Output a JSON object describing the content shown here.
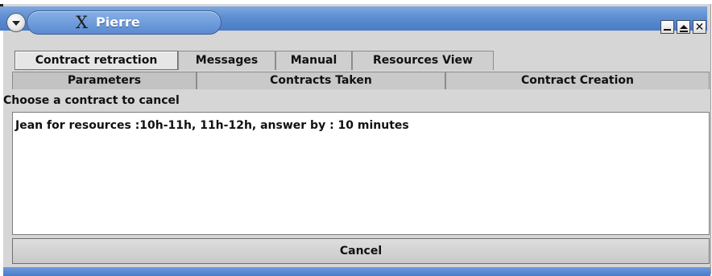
{
  "window": {
    "title": "Pierre",
    "title_icon": "x-logo-icon",
    "controls": [
      "minimize-icon",
      "maximize-icon",
      "close-icon"
    ]
  },
  "tabs_row1": [
    {
      "label": "Contract retraction",
      "active": true
    },
    {
      "label": "Messages",
      "active": false
    },
    {
      "label": "Manual",
      "active": false
    },
    {
      "label": "Resources View",
      "active": false
    }
  ],
  "tabs_row2": [
    {
      "label": "Parameters"
    },
    {
      "label": "Contracts Taken"
    },
    {
      "label": "Contract Creation"
    }
  ],
  "content": {
    "section_label": "Choose a contract to cancel",
    "contracts": [
      "Jean for resources :10h-11h, 11h-12h,  answer by : 10 minutes"
    ],
    "cancel_label": "Cancel"
  },
  "colors": {
    "titlebar": "#5d8ed2",
    "window_bg": "#d6d6d6",
    "list_bg": "#ffffff"
  }
}
